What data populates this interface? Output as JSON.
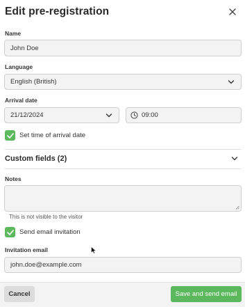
{
  "header": {
    "title": "Edit pre-registration",
    "close_icon": "close-icon"
  },
  "name": {
    "label": "Name",
    "value": "John Doe"
  },
  "language": {
    "label": "Language",
    "selected": "English (British)"
  },
  "arrival": {
    "label": "Arrival date",
    "date": "21/12/2024",
    "time": "09:00",
    "set_time_label": "Set time of arrival date",
    "set_time_checked": true
  },
  "custom_fields": {
    "title": "Custom fields (2)",
    "expanded": false
  },
  "notes": {
    "label": "Notes",
    "value": "",
    "helper": "This is not visible to the visitor"
  },
  "invitation": {
    "send_label": "Send email invitation",
    "send_checked": true,
    "email_label": "Invitation email",
    "email_value": "john.doe@example.com"
  },
  "footer": {
    "cancel_label": "Cancel",
    "save_label": "Save and send email"
  },
  "colors": {
    "accent": "#5cb85c",
    "field_bg": "#f3f3f3",
    "border": "#cfcfcf"
  }
}
